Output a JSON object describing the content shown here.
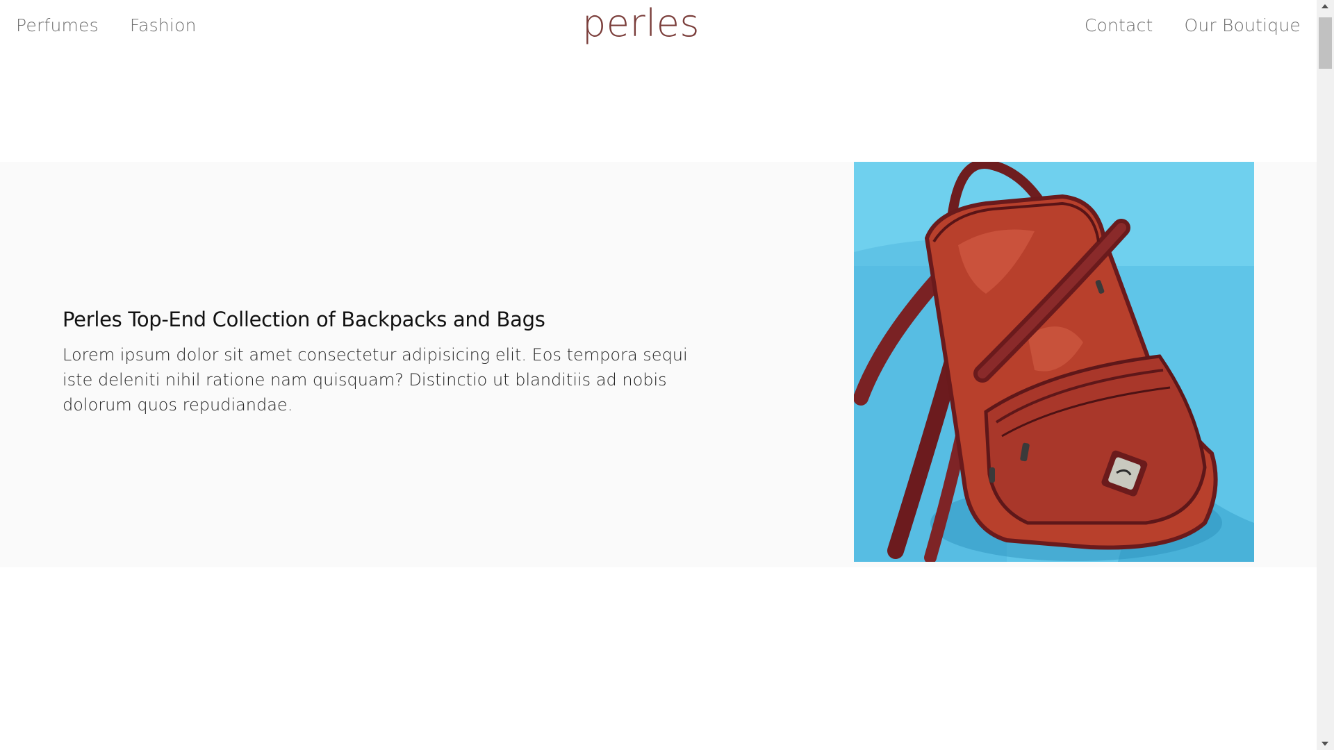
{
  "header": {
    "logo": "perles",
    "nav_left": [
      "Perfumes",
      "Fashion"
    ],
    "nav_right": [
      "Contact",
      "Our Boutique"
    ]
  },
  "feature": {
    "title": "Perles Top-End Collection of Backpacks and Bags",
    "body": "Lorem ipsum dolor sit amet consectetur adipisicing elit. Eos tempora sequi iste deleniti nihil ratione nam quisquam? Distinctio ut blanditiis ad nobis dolorum quos repudiandae.",
    "image": "red-leather-backpack-photo"
  },
  "colors": {
    "logo": "#7a3d3a",
    "nav_text": "#6d6d6d",
    "section_bg": "#fafafa",
    "image_bg": "#5cc3e6",
    "backpack": "#b8402c"
  }
}
